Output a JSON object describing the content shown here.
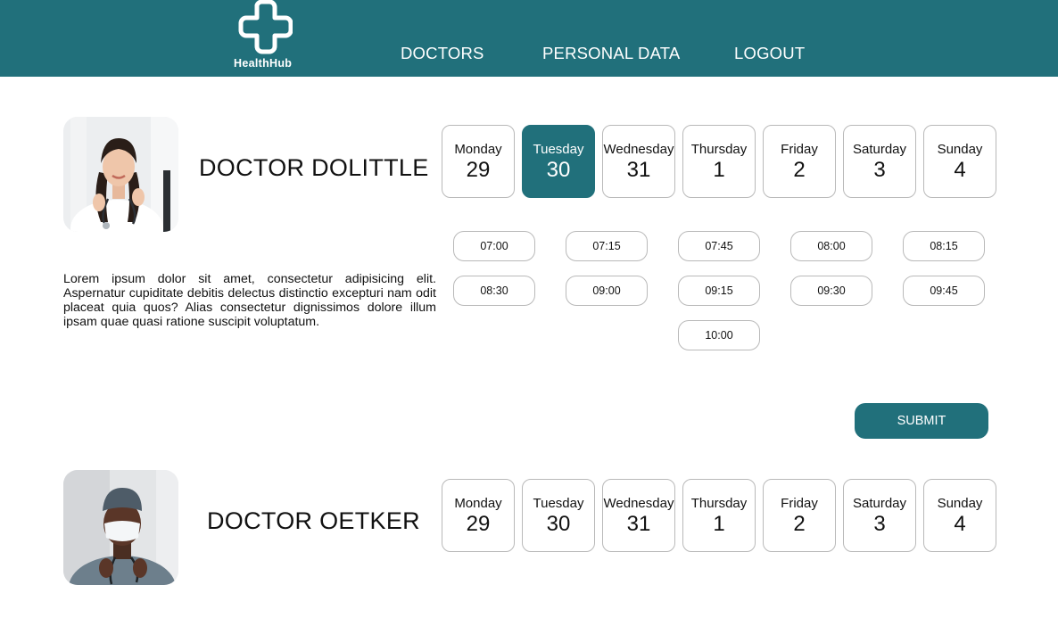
{
  "brand": {
    "name": "HealthHub",
    "icon": "medical-cross-icon",
    "color": "#21707b"
  },
  "nav": {
    "items": [
      "DOCTORS",
      "PERSONAL DATA",
      "LOGOUT"
    ]
  },
  "doctors": [
    {
      "name": "DOCTOR DOLITTLE",
      "description": "Lorem ipsum dolor sit amet, consectetur adipisicing elit. Aspernatur cupiditate debitis delectus distinctio excepturi nam odit placeat quia quos? Alias consectetur dignissimos dolore illum ipsam quae quasi ratione suscipit voluptatum.",
      "selected_day": "Tuesday",
      "days": [
        {
          "day": "Monday",
          "date": "29"
        },
        {
          "day": "Tuesday",
          "date": "30"
        },
        {
          "day": "Wednesday",
          "date": "31"
        },
        {
          "day": "Thursday",
          "date": "1"
        },
        {
          "day": "Friday",
          "date": "2"
        },
        {
          "day": "Saturday",
          "date": "3"
        },
        {
          "day": "Sunday",
          "date": "4"
        }
      ],
      "slots": [
        "07:00",
        "07:15",
        "07:45",
        "08:00",
        "08:15",
        "08:30",
        "09:00",
        "09:15",
        "09:30",
        "09:45",
        "10:00"
      ],
      "submit_label": "SUBMIT"
    },
    {
      "name": "DOCTOR OETKER",
      "days": [
        {
          "day": "Monday",
          "date": "29"
        },
        {
          "day": "Tuesday",
          "date": "30"
        },
        {
          "day": "Wednesday",
          "date": "31"
        },
        {
          "day": "Thursday",
          "date": "1"
        },
        {
          "day": "Friday",
          "date": "2"
        },
        {
          "day": "Saturday",
          "date": "3"
        },
        {
          "day": "Sunday",
          "date": "4"
        }
      ]
    }
  ]
}
